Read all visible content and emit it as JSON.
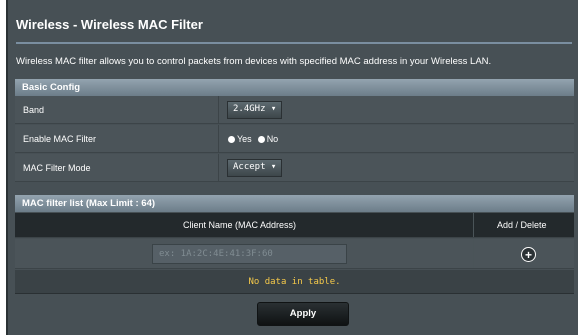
{
  "page": {
    "title": "Wireless - Wireless MAC Filter",
    "description": "Wireless MAC filter allows you to control packets from devices with specified MAC address in your Wireless LAN."
  },
  "basic_config": {
    "header": "Basic Config",
    "band": {
      "label": "Band",
      "value": "2.4GHz ▾"
    },
    "enable_mac_filter": {
      "label": "Enable MAC Filter",
      "yes_label": "Yes",
      "no_label": "No",
      "selected": "Yes"
    },
    "mac_filter_mode": {
      "label": "MAC Filter Mode",
      "value": "Accept ▾"
    }
  },
  "mac_list": {
    "header": "MAC filter list (Max Limit : 64)",
    "col_client": "Client Name (MAC Address)",
    "col_action": "Add / Delete",
    "input_placeholder": "ex: 1A:2C:4E:41:3F:60",
    "add_icon": "+",
    "empty_text": "No data in table."
  },
  "apply_label": "Apply",
  "colors": {
    "panel_bg": "#475055",
    "header_gradient_top": "#93a3af",
    "empty_text": "#f5c94a"
  }
}
